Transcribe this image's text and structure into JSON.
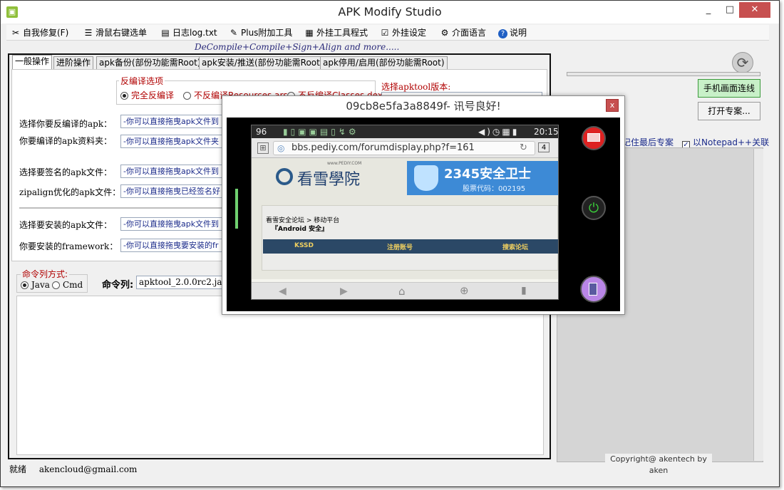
{
  "window": {
    "title": "APK Modify Studio",
    "min": "_",
    "max": "□",
    "close": "✕",
    "app_icon": "android-icon"
  },
  "menu": [
    {
      "label": "自我修复(F)",
      "icon": "tools-icon"
    },
    {
      "label": "滑鼠右键选单",
      "icon": "list-icon"
    },
    {
      "label": "日志log.txt",
      "icon": "document-icon"
    },
    {
      "label": "Plus附加工具",
      "icon": "pencil-icon"
    },
    {
      "label": "外挂工具程式",
      "icon": "keyboard-icon"
    },
    {
      "label": "外挂设定",
      "icon": "checklist-icon"
    },
    {
      "label": "介面语言",
      "icon": "gear-icon"
    },
    {
      "label": "说明",
      "icon": "help-icon"
    }
  ],
  "subtitle": "DeCompile+Compile+Sign+Align and more.....",
  "tabs": [
    "一般操作",
    "进阶操作",
    "apk备份(部份功能需Root)",
    "apk安装/推送(部份功能需Root)",
    "apk停用/启用(部份功能需Root)"
  ],
  "decompile": {
    "group_label": "反编译选项",
    "options": [
      "完全反编译",
      "不反编译Resources.arsc",
      "不反编译Classes.dex"
    ],
    "selected_option": "完全反编译",
    "apktool_label": "选择apktool版本:"
  },
  "fields": [
    {
      "label": "选择你要反编译的apk：",
      "value": "-你可以直接拖曳apk文件到"
    },
    {
      "label": "你要编译的apk资料夹：",
      "value": "-你可以直接拖曳apk文件夹"
    },
    {
      "label": "选择要签名的apk文件：",
      "value": "-你可以直接拖曳apk文件到"
    },
    {
      "label": "zipalign优化的apk文件：",
      "value": "-你可以直接拖曳已经签名好"
    },
    {
      "label": "选择要安装的apk文件：",
      "value": "-你可以直接拖曳apk文件到"
    },
    {
      "label": "你要安装的framework：",
      "value": "-你可以直接拖曳要安装的fr"
    }
  ],
  "command": {
    "mode_label": "命令列方式:",
    "modes": [
      "Java",
      "Cmd"
    ],
    "selected_mode": "Java",
    "cmd_label": "命令列:",
    "cmd_value": "apktool_2.0.0rc2.jar -?"
  },
  "right": {
    "connect_button": "手机画面连线",
    "open_project_button": "打开专案...",
    "remember_label": "记住最后专案",
    "notepad_label": "以Notepad++关联",
    "notepad_checked": "✓",
    "refresh_icon": "refresh-icon"
  },
  "copyright": "Copyright@ akentech by aken",
  "status": {
    "state": "就绪",
    "email": "akencloud@gmail.com"
  },
  "dialog": {
    "title": "09cb8e5fa3a8849f- 讯号良好!",
    "close": "x",
    "phone": {
      "signal": "96",
      "time": "20:15",
      "url": "bbs.pediy.com/forumdisplay.php?f=161",
      "tab_count": "4",
      "site_name": "看雪學院",
      "site_domain": "www.PEDIY.COM",
      "banner_title": "2345安全卫士",
      "banner_sub": "股票代码：002195",
      "breadcrumb_1": "看雪安全论坛",
      "breadcrumb_2": "> 移动平台",
      "breadcrumb_3": "『Android 安全』",
      "nav_items": [
        "KSSD",
        "注册账号",
        "搜索论坛"
      ]
    }
  }
}
